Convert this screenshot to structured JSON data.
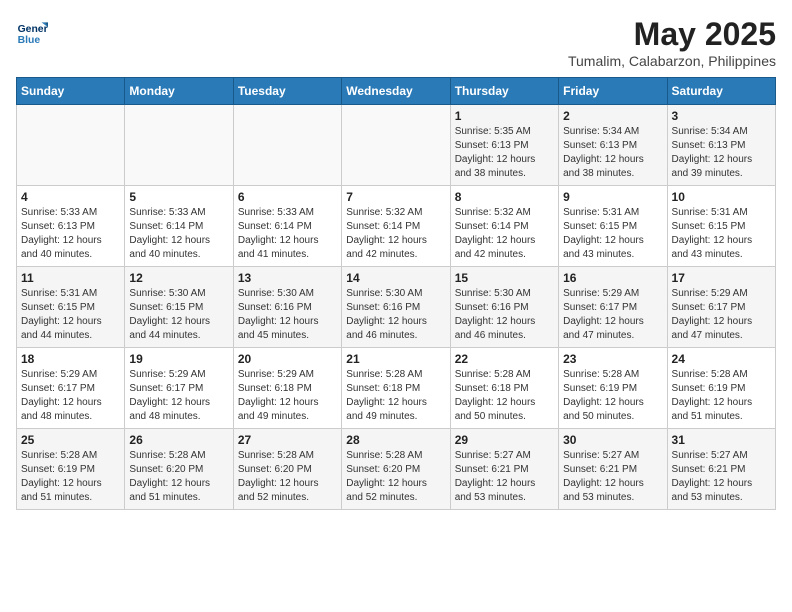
{
  "header": {
    "logo_line1": "General",
    "logo_line2": "Blue",
    "title": "May 2025",
    "subtitle": "Tumalim, Calabarzon, Philippines"
  },
  "calendar": {
    "days_of_week": [
      "Sunday",
      "Monday",
      "Tuesday",
      "Wednesday",
      "Thursday",
      "Friday",
      "Saturday"
    ],
    "weeks": [
      [
        {
          "day": "",
          "info": ""
        },
        {
          "day": "",
          "info": ""
        },
        {
          "day": "",
          "info": ""
        },
        {
          "day": "",
          "info": ""
        },
        {
          "day": "1",
          "info": "Sunrise: 5:35 AM\nSunset: 6:13 PM\nDaylight: 12 hours\nand 38 minutes."
        },
        {
          "day": "2",
          "info": "Sunrise: 5:34 AM\nSunset: 6:13 PM\nDaylight: 12 hours\nand 38 minutes."
        },
        {
          "day": "3",
          "info": "Sunrise: 5:34 AM\nSunset: 6:13 PM\nDaylight: 12 hours\nand 39 minutes."
        }
      ],
      [
        {
          "day": "4",
          "info": "Sunrise: 5:33 AM\nSunset: 6:13 PM\nDaylight: 12 hours\nand 40 minutes."
        },
        {
          "day": "5",
          "info": "Sunrise: 5:33 AM\nSunset: 6:14 PM\nDaylight: 12 hours\nand 40 minutes."
        },
        {
          "day": "6",
          "info": "Sunrise: 5:33 AM\nSunset: 6:14 PM\nDaylight: 12 hours\nand 41 minutes."
        },
        {
          "day": "7",
          "info": "Sunrise: 5:32 AM\nSunset: 6:14 PM\nDaylight: 12 hours\nand 42 minutes."
        },
        {
          "day": "8",
          "info": "Sunrise: 5:32 AM\nSunset: 6:14 PM\nDaylight: 12 hours\nand 42 minutes."
        },
        {
          "day": "9",
          "info": "Sunrise: 5:31 AM\nSunset: 6:15 PM\nDaylight: 12 hours\nand 43 minutes."
        },
        {
          "day": "10",
          "info": "Sunrise: 5:31 AM\nSunset: 6:15 PM\nDaylight: 12 hours\nand 43 minutes."
        }
      ],
      [
        {
          "day": "11",
          "info": "Sunrise: 5:31 AM\nSunset: 6:15 PM\nDaylight: 12 hours\nand 44 minutes."
        },
        {
          "day": "12",
          "info": "Sunrise: 5:30 AM\nSunset: 6:15 PM\nDaylight: 12 hours\nand 44 minutes."
        },
        {
          "day": "13",
          "info": "Sunrise: 5:30 AM\nSunset: 6:16 PM\nDaylight: 12 hours\nand 45 minutes."
        },
        {
          "day": "14",
          "info": "Sunrise: 5:30 AM\nSunset: 6:16 PM\nDaylight: 12 hours\nand 46 minutes."
        },
        {
          "day": "15",
          "info": "Sunrise: 5:30 AM\nSunset: 6:16 PM\nDaylight: 12 hours\nand 46 minutes."
        },
        {
          "day": "16",
          "info": "Sunrise: 5:29 AM\nSunset: 6:17 PM\nDaylight: 12 hours\nand 47 minutes."
        },
        {
          "day": "17",
          "info": "Sunrise: 5:29 AM\nSunset: 6:17 PM\nDaylight: 12 hours\nand 47 minutes."
        }
      ],
      [
        {
          "day": "18",
          "info": "Sunrise: 5:29 AM\nSunset: 6:17 PM\nDaylight: 12 hours\nand 48 minutes."
        },
        {
          "day": "19",
          "info": "Sunrise: 5:29 AM\nSunset: 6:17 PM\nDaylight: 12 hours\nand 48 minutes."
        },
        {
          "day": "20",
          "info": "Sunrise: 5:29 AM\nSunset: 6:18 PM\nDaylight: 12 hours\nand 49 minutes."
        },
        {
          "day": "21",
          "info": "Sunrise: 5:28 AM\nSunset: 6:18 PM\nDaylight: 12 hours\nand 49 minutes."
        },
        {
          "day": "22",
          "info": "Sunrise: 5:28 AM\nSunset: 6:18 PM\nDaylight: 12 hours\nand 50 minutes."
        },
        {
          "day": "23",
          "info": "Sunrise: 5:28 AM\nSunset: 6:19 PM\nDaylight: 12 hours\nand 50 minutes."
        },
        {
          "day": "24",
          "info": "Sunrise: 5:28 AM\nSunset: 6:19 PM\nDaylight: 12 hours\nand 51 minutes."
        }
      ],
      [
        {
          "day": "25",
          "info": "Sunrise: 5:28 AM\nSunset: 6:19 PM\nDaylight: 12 hours\nand 51 minutes."
        },
        {
          "day": "26",
          "info": "Sunrise: 5:28 AM\nSunset: 6:20 PM\nDaylight: 12 hours\nand 51 minutes."
        },
        {
          "day": "27",
          "info": "Sunrise: 5:28 AM\nSunset: 6:20 PM\nDaylight: 12 hours\nand 52 minutes."
        },
        {
          "day": "28",
          "info": "Sunrise: 5:28 AM\nSunset: 6:20 PM\nDaylight: 12 hours\nand 52 minutes."
        },
        {
          "day": "29",
          "info": "Sunrise: 5:27 AM\nSunset: 6:21 PM\nDaylight: 12 hours\nand 53 minutes."
        },
        {
          "day": "30",
          "info": "Sunrise: 5:27 AM\nSunset: 6:21 PM\nDaylight: 12 hours\nand 53 minutes."
        },
        {
          "day": "31",
          "info": "Sunrise: 5:27 AM\nSunset: 6:21 PM\nDaylight: 12 hours\nand 53 minutes."
        }
      ]
    ]
  }
}
